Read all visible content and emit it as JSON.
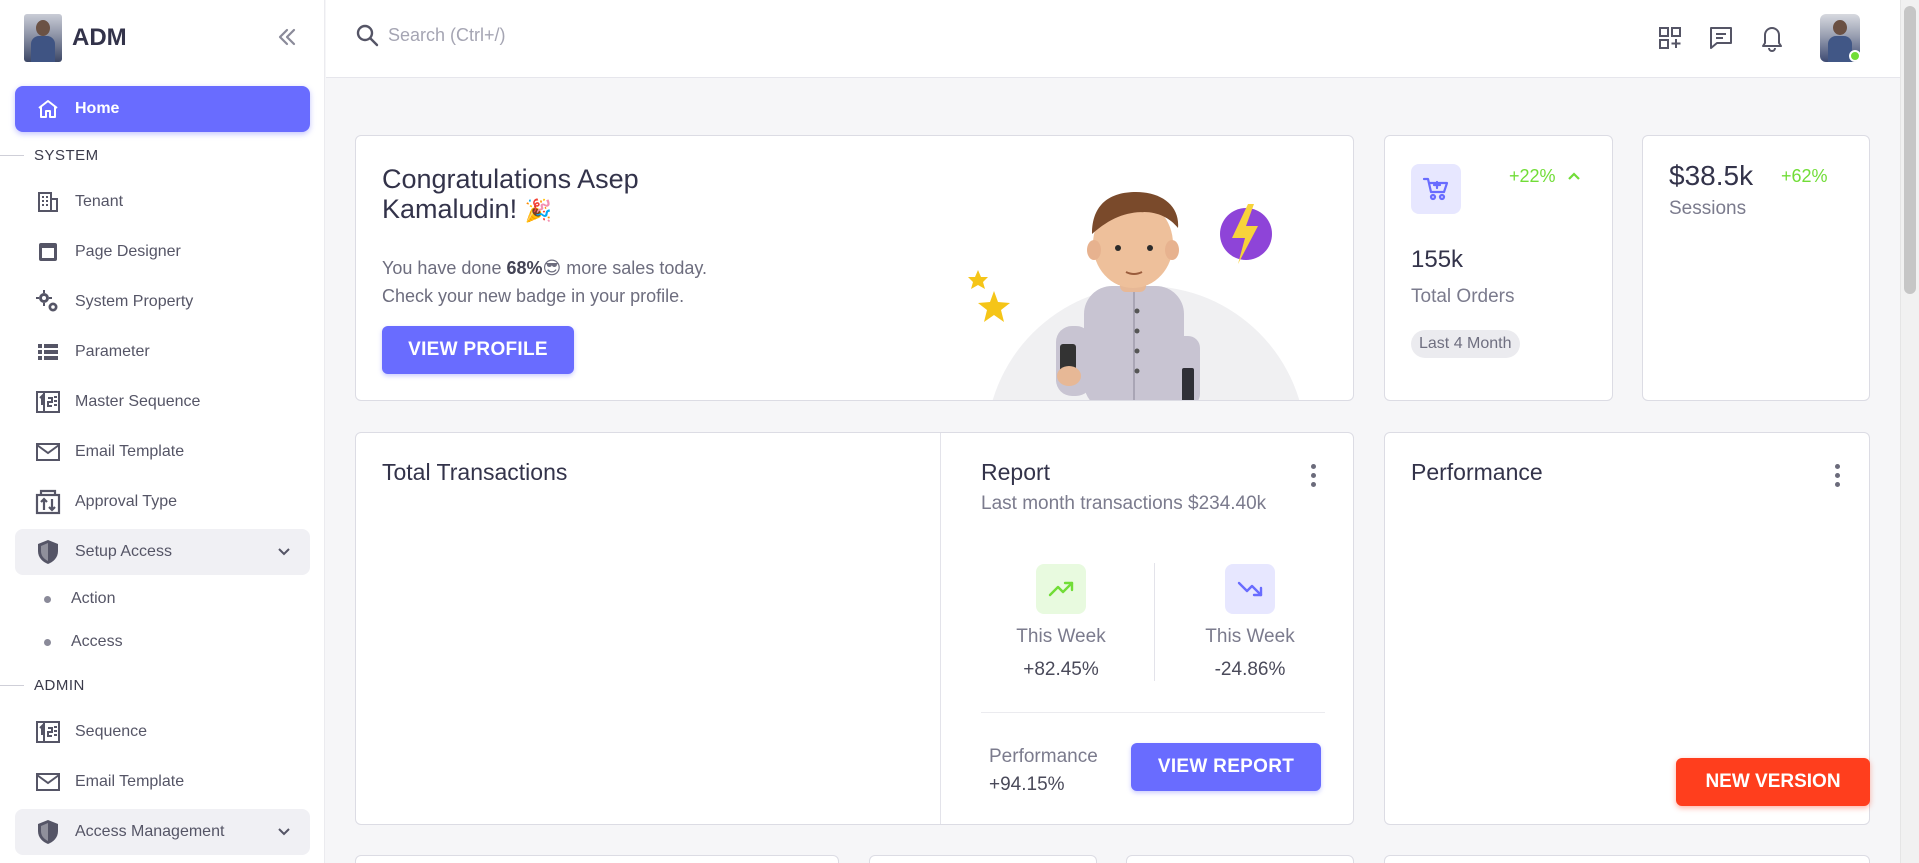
{
  "brand": {
    "name": "ADM"
  },
  "sidebar": {
    "home": "Home",
    "section_system": "SYSTEM",
    "system_items": [
      {
        "label": "Tenant",
        "icon": "building-icon"
      },
      {
        "label": "Page Designer",
        "icon": "layout-icon"
      },
      {
        "label": "System Property",
        "icon": "gears-icon"
      },
      {
        "label": "Parameter",
        "icon": "list-icon"
      },
      {
        "label": "Master Sequence",
        "icon": "numbered-icon"
      },
      {
        "label": "Email Template",
        "icon": "mail-icon"
      },
      {
        "label": "Approval Type",
        "icon": "sort-icon"
      }
    ],
    "setup_access": "Setup Access",
    "setup_sub": [
      "Action",
      "Access"
    ],
    "section_admin": "ADMIN",
    "admin_items": [
      {
        "label": "Sequence",
        "icon": "numbered-icon"
      },
      {
        "label": "Email Template",
        "icon": "mail-icon"
      }
    ],
    "access_management": "Access Management"
  },
  "topbar": {
    "search_placeholder": "Search (Ctrl+/)",
    "icons": [
      "apps-add-icon",
      "chat-icon",
      "bell-icon"
    ]
  },
  "welcome": {
    "title_line1": "Congratulations Asep",
    "title_line2": "Kamaludin!",
    "title_emoji": "🎉",
    "line1_prefix": "You have done",
    "line1_value": "68%",
    "line1_emoji": "😎",
    "line1_suffix": "more sales today.",
    "line2": "Check your new badge in your profile.",
    "button": "VIEW PROFILE"
  },
  "orders": {
    "change": "+22%",
    "value": "155k",
    "label": "Total Orders",
    "chip": "Last 4 Month"
  },
  "sessions": {
    "value": "$38.5k",
    "change": "+62%",
    "label": "Sessions"
  },
  "transactions": {
    "title": "Total Transactions"
  },
  "report": {
    "title": "Report",
    "subtitle": "Last month transactions $234.40k",
    "up": {
      "label": "This Week",
      "value": "+82.45%"
    },
    "down": {
      "label": "This Week",
      "value": "-24.86%"
    },
    "perf_label": "Performance",
    "perf_value": "+94.15%",
    "button": "VIEW REPORT"
  },
  "performance": {
    "title": "Performance"
  },
  "new_version": "NEW VERSION",
  "colors": {
    "primary": "#696cff",
    "success": "#71dd37",
    "danger": "#ff3e1d"
  }
}
